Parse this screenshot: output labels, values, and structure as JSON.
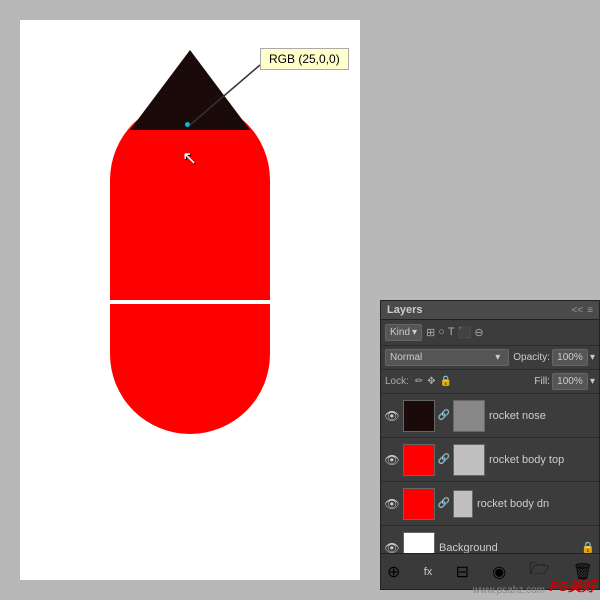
{
  "canvas": {
    "bg_color": "#b8b8b8",
    "white_area_color": "#ffffff"
  },
  "tooltip": {
    "text": "RGB (25,0,0)"
  },
  "layers_panel": {
    "title": "Layers",
    "collapse_label": "<<",
    "expand_label": ">>",
    "menu_icon": "≡",
    "search": {
      "kind_label": "Kind",
      "kind_arrow": "▾",
      "icons": [
        "⊞",
        "○",
        "T",
        "⬛",
        "⊖"
      ]
    },
    "blend_mode": {
      "label": "Normal",
      "arrow": "▾"
    },
    "opacity": {
      "label": "Opacity:",
      "value": "100%",
      "arrow": "▾"
    },
    "lock": {
      "label": "Lock:",
      "icons": [
        "✏",
        "✥",
        "🔒"
      ]
    },
    "fill": {
      "label": "Fill:",
      "value": "100%",
      "arrow": "▾"
    },
    "layers": [
      {
        "name": "rocket nose",
        "visible": true,
        "thumb_color": "#1a0a0a",
        "mask_color": "#888888",
        "has_link": true,
        "active": false
      },
      {
        "name": "rocket body top",
        "visible": true,
        "thumb_color": "#ff0000",
        "mask_color": "#c8c8c8",
        "has_link": true,
        "active": false
      },
      {
        "name": "rocket body dn",
        "visible": true,
        "thumb_color": "#ff0000",
        "mask_color": "#c8c8c8",
        "has_link": true,
        "active": false
      },
      {
        "name": "Background",
        "visible": true,
        "thumb_color": "#ffffff",
        "mask_color": null,
        "has_link": false,
        "active": false,
        "locked": true
      }
    ],
    "toolbar": {
      "icons": [
        "⊕",
        "fx",
        "⊟",
        "◉",
        "🗁",
        "🗑"
      ]
    }
  },
  "watermark": {
    "site": "www.psahz.com",
    "brand": "PS美好"
  }
}
